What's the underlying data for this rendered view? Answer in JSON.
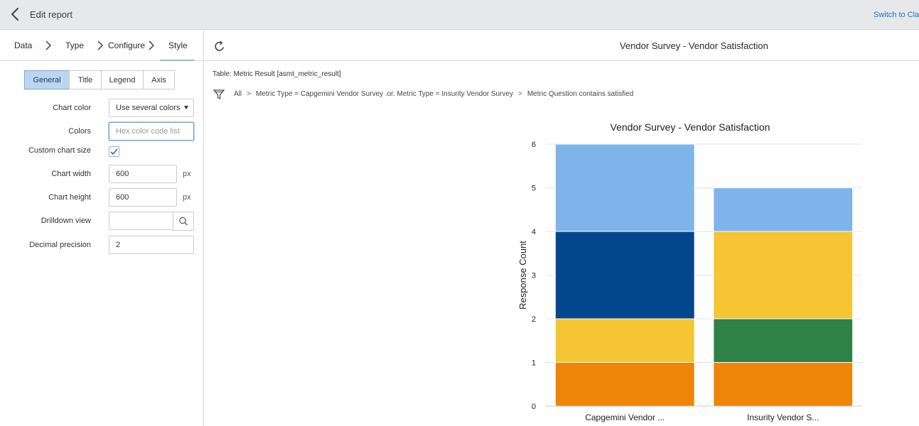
{
  "header": {
    "title": "Edit report",
    "switch_link": "Switch to Clas"
  },
  "steps": [
    "Data",
    "Type",
    "Configure",
    "Style"
  ],
  "style_tabs": [
    "General",
    "Title",
    "Legend",
    "Axis"
  ],
  "form": {
    "chart_color_label": "Chart color",
    "chart_color_value": "Use several colors",
    "colors_label": "Colors",
    "colors_placeholder": "Hex color code list",
    "custom_size_label": "Custom chart size",
    "custom_size_checked": true,
    "width_label": "Chart width",
    "width_value": "600",
    "height_label": "Chart height",
    "height_value": "600",
    "unit": "px",
    "drilldown_label": "Drilldown view",
    "drilldown_value": "",
    "decimal_label": "Decimal precision",
    "decimal_value": "2"
  },
  "report": {
    "title": "Vendor Survey - Vendor Satisfaction",
    "table": "Table: Metric Result [asmt_metric_result]",
    "filters": [
      "All",
      "Metric Type = Capgemini Vendor Survey .or. Metric Type = Insurity Vendor Survey",
      "Metric Question contains satisfied"
    ],
    "filter_separator": ">"
  },
  "chart_data": {
    "type": "bar",
    "stacked": true,
    "title": "Vendor Survey - Vendor Satisfaction",
    "xlabel": "",
    "ylabel": "Response Count",
    "ylim": [
      0,
      6
    ],
    "yticks": [
      0,
      1,
      2,
      3,
      4,
      5,
      6
    ],
    "grid": true,
    "categories": [
      "Capgemini Vendor ...",
      "Insurity Vendor S..."
    ],
    "series": [
      {
        "color": "#ee8408",
        "values": [
          1,
          1
        ]
      },
      {
        "color": "#f5c533",
        "values": [
          1,
          0
        ]
      },
      {
        "color": "#2f8147",
        "values": [
          0,
          1
        ]
      },
      {
        "color": "#f5c533",
        "values": [
          0,
          2
        ]
      },
      {
        "color": "#02468b",
        "values": [
          2,
          0
        ]
      },
      {
        "color": "#7db5eb",
        "values": [
          2,
          1
        ]
      }
    ]
  }
}
